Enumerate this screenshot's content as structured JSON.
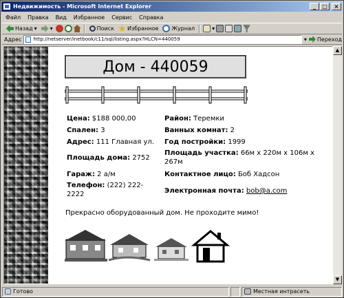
{
  "window": {
    "title": "Недвижимость - Microsoft Internet Explorer"
  },
  "menu": [
    "Файл",
    "Правка",
    "Вид",
    "Избранное",
    "Сервис",
    "Справка"
  ],
  "toolbar": {
    "back": "Назад",
    "search": "Поиск",
    "favorites": "Избранное",
    "history": "Журнал"
  },
  "address": {
    "label": "Адрес",
    "url": "http://netserver/inetbook/c11/sql/listing.aspx?HLCN=440059",
    "go": "Переход"
  },
  "listing": {
    "title": "Дом - 440059",
    "left": [
      {
        "label": "Цена:",
        "value": "$188 000,00"
      },
      {
        "label": "Спален:",
        "value": "3"
      },
      {
        "label": "Адрес:",
        "value": "111 Главная ул."
      },
      {
        "label": "Площадь дома:",
        "value": "2752"
      },
      {
        "label": "Гараж:",
        "value": "2 а/м"
      },
      {
        "label": "Телефон:",
        "value": "(222) 222-2222"
      }
    ],
    "right": [
      {
        "label": "Район:",
        "value": "Теремки"
      },
      {
        "label": "Ванных комнат:",
        "value": "2"
      },
      {
        "label": "Год постройки:",
        "value": "1999"
      },
      {
        "label": "Площадь участка:",
        "value": "66м x 220м x 106м x 267м"
      },
      {
        "label": "Контактное лицо:",
        "value": "Боб Хадсон"
      },
      {
        "label": "Электронная почта:",
        "value": "bob@a.com"
      }
    ],
    "description": "Прекрасно оборудованный дом. Не проходите мимо!"
  },
  "status": {
    "text": "Готово",
    "zone": "Местная интрасеть"
  }
}
